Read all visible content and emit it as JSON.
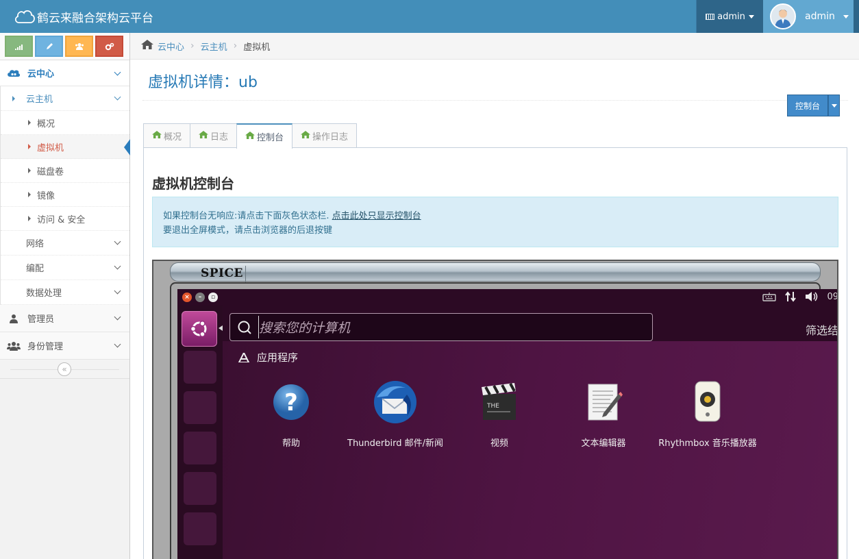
{
  "navbar": {
    "brand": "鹤云来融合架构云平台",
    "admin_menu": "admin",
    "user_name": "admin"
  },
  "sidebar": {
    "shortcuts": [
      "signal-icon",
      "pencil-icon",
      "users-icon",
      "cogs-icon"
    ],
    "cloud_center": "云中心",
    "cloud_host": "云主机",
    "sub_items": [
      "概况",
      "虚拟机",
      "磁盘卷",
      "镜像",
      "访问 & 安全"
    ],
    "sections": [
      "网络",
      "编配",
      "数据处理"
    ],
    "top_items": [
      "管理员",
      "身份管理"
    ]
  },
  "breadcrumb": {
    "items": [
      "云中心",
      "云主机",
      "虚拟机"
    ]
  },
  "main": {
    "title": "虚拟机详情：ub",
    "console_button": "控制台",
    "tabs": [
      "概况",
      "日志",
      "控制台",
      "操作日志"
    ],
    "section_title": "虚拟机控制台",
    "alert_line1": "如果控制台无响应:请点击下面灰色状态栏.",
    "alert_link": "点击此处只显示控制台",
    "alert_line2": "要退出全屏模式，请点击浏览器的后退按键"
  },
  "spice": {
    "label": "SPICE",
    "search_placeholder": "搜索您的计算机",
    "filter": "筛选结",
    "time": "09",
    "apps_heading": "应用程序",
    "apps": [
      "帮助",
      "Thunderbird 邮件/新闻",
      "视频",
      "文本编辑器",
      "Rhythmbox 音乐播放器"
    ]
  }
}
